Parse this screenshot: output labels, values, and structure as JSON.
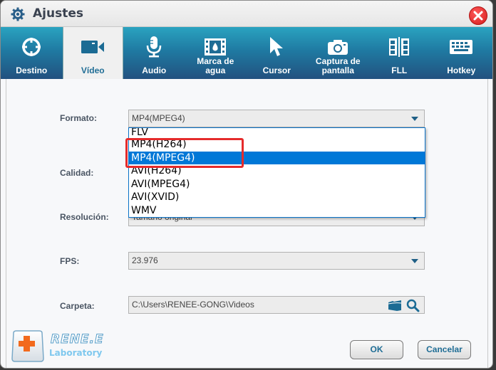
{
  "window": {
    "title": "Ajustes",
    "close_icon": "close-icon"
  },
  "tabs": [
    {
      "label": "Destino",
      "icon": "crosshair-icon",
      "active": false
    },
    {
      "label": "Vídeo",
      "icon": "video-camera-icon",
      "active": true
    },
    {
      "label": "Audio",
      "icon": "microphone-icon",
      "active": false
    },
    {
      "label": "Marca de agua",
      "icon": "watermark-film-icon",
      "active": false
    },
    {
      "label": "Cursor",
      "icon": "cursor-arrow-icon",
      "active": false
    },
    {
      "label": "Captura de pantalla",
      "icon": "camera-icon",
      "active": false
    },
    {
      "label": "FLL",
      "icon": "film-split-icon",
      "active": false
    },
    {
      "label": "Hotkey",
      "icon": "keyboard-icon",
      "active": false
    }
  ],
  "form": {
    "formato": {
      "label": "Formato:",
      "value": "MP4(MPEG4)"
    },
    "calidad": {
      "label": "Calidad:"
    },
    "resolucion": {
      "label": "Resolución:",
      "value": "Tamaño original"
    },
    "fps": {
      "label": "FPS:",
      "value": "23.976"
    },
    "carpeta": {
      "label": "Carpeta:",
      "value": "C:\\Users\\RENEE-GONG\\Videos"
    }
  },
  "dropdown": {
    "options": [
      "FLV",
      "MP4(H264)",
      "MP4(MPEG4)",
      "AVI(H264)",
      "AVI(MPEG4)",
      "AVI(XVID)",
      "WMV"
    ],
    "selected": "MP4(MPEG4)",
    "highlighted_annotation": [
      "MP4(H264)",
      "MP4(MPEG4)"
    ],
    "annotation_color": "#e52b2b",
    "selection_color": "#0078d7"
  },
  "buttons": {
    "ok": "OK",
    "cancel": "Cancelar"
  },
  "branding": {
    "title": "RENE.E",
    "subtitle": "Laboratory"
  },
  "colors": {
    "tab_bar_top": "#2aa3c0",
    "tab_bar_bottom": "#22517f",
    "accent_text": "#1f6d95"
  }
}
